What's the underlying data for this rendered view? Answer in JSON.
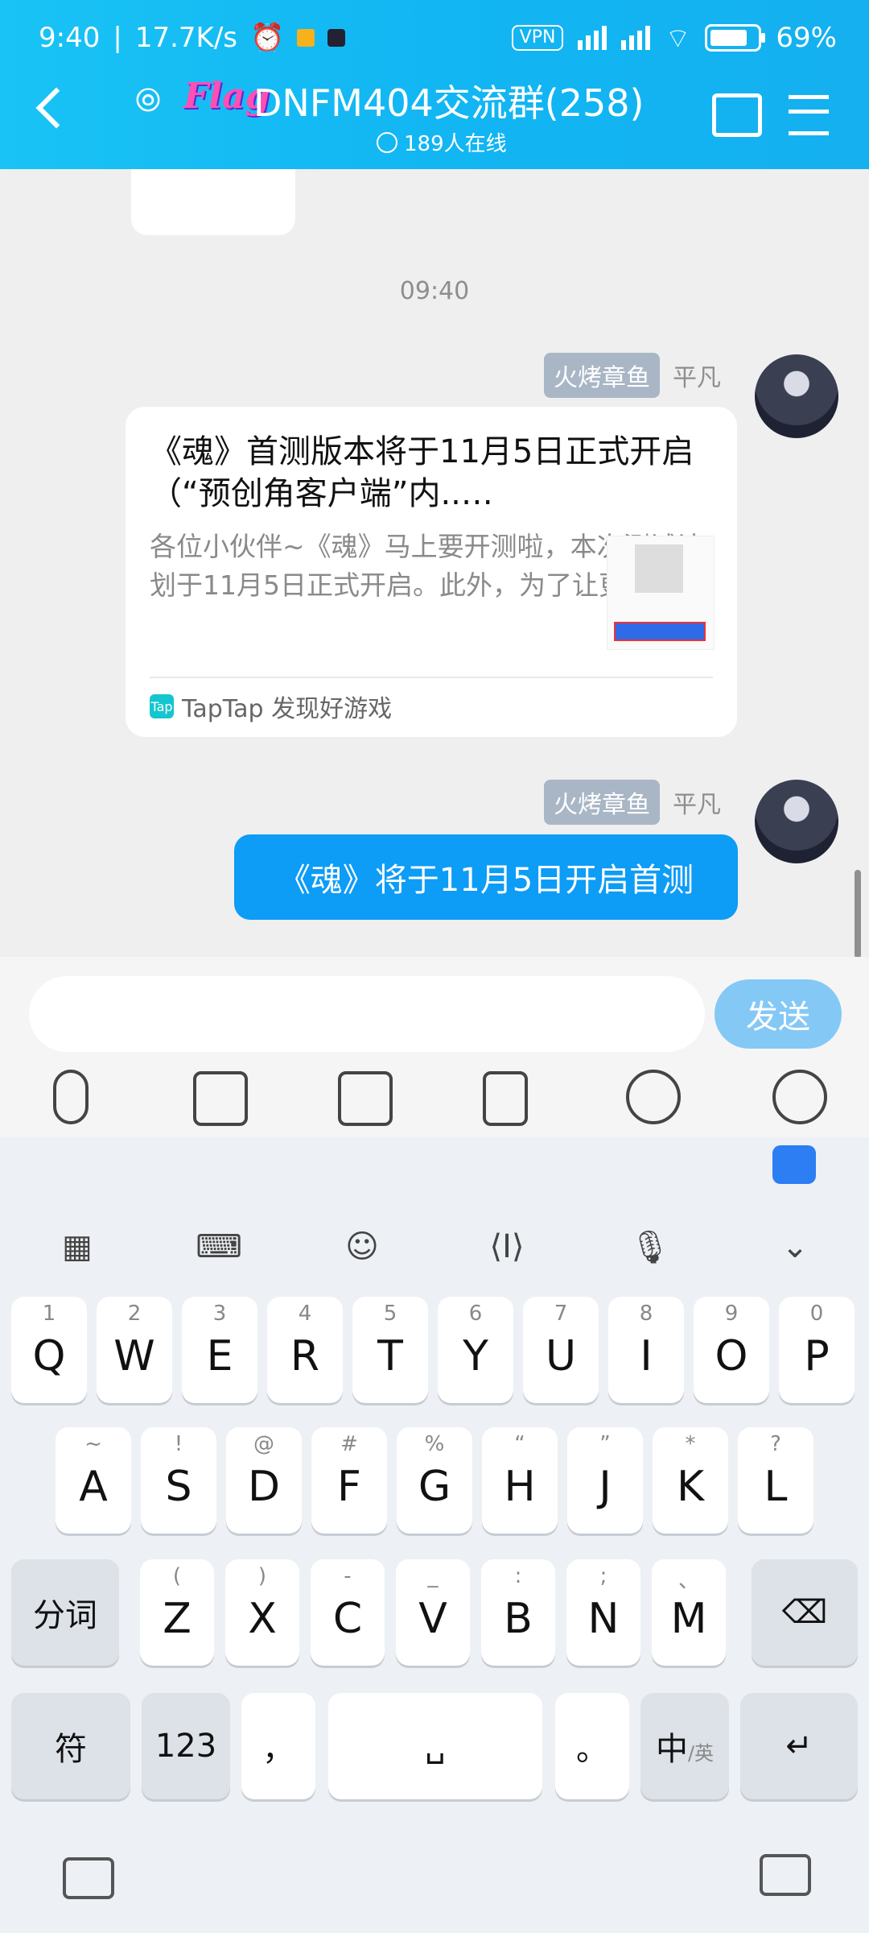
{
  "status_bar": {
    "time": "9:40",
    "speed": "17.7K/s",
    "vpn": "VPN",
    "battery": "69%"
  },
  "header": {
    "logo_text": "Flag",
    "title": "DNFM404交流群(258)",
    "online": "189人在线"
  },
  "chat": {
    "time_separator": "09:40",
    "messages": [
      {
        "tag": "火烤章鱼",
        "name": "平凡",
        "card": {
          "title": "《魂》首测版本将于11月5日正式开启（“预创角客户端”内..…",
          "desc": "各位小伙伴~《魂》马上要开测啦，本次测试计划于11月5日正式开启。此外，为了让更…",
          "source": "TapTap 发现好游戏"
        }
      },
      {
        "tag": "火烤章鱼",
        "name": "平凡",
        "text": "《魂》将于11月5日开启首测"
      }
    ]
  },
  "input": {
    "placeholder": "",
    "send_label": "发送"
  },
  "keyboard": {
    "row1": [
      {
        "sub": "1",
        "main": "Q"
      },
      {
        "sub": "2",
        "main": "W"
      },
      {
        "sub": "3",
        "main": "E"
      },
      {
        "sub": "4",
        "main": "R"
      },
      {
        "sub": "5",
        "main": "T"
      },
      {
        "sub": "6",
        "main": "Y"
      },
      {
        "sub": "7",
        "main": "U"
      },
      {
        "sub": "8",
        "main": "I"
      },
      {
        "sub": "9",
        "main": "O"
      },
      {
        "sub": "0",
        "main": "P"
      }
    ],
    "row2": [
      {
        "sub": "~",
        "main": "A"
      },
      {
        "sub": "!",
        "main": "S"
      },
      {
        "sub": "@",
        "main": "D"
      },
      {
        "sub": "#",
        "main": "F"
      },
      {
        "sub": "%",
        "main": "G"
      },
      {
        "sub": "“",
        "main": "H"
      },
      {
        "sub": "”",
        "main": "J"
      },
      {
        "sub": "*",
        "main": "K"
      },
      {
        "sub": "?",
        "main": "L"
      }
    ],
    "row3": [
      {
        "sub": "(",
        "main": "Z"
      },
      {
        "sub": ")",
        "main": "X"
      },
      {
        "sub": "-",
        "main": "C"
      },
      {
        "sub": "_",
        "main": "V"
      },
      {
        "sub": ":",
        "main": "B"
      },
      {
        "sub": ";",
        "main": "N"
      },
      {
        "sub": "、",
        "main": "M"
      }
    ],
    "fenci": "分词",
    "fu": "符",
    "num": "123",
    "comma": "，",
    "period": "。",
    "zh": "中",
    "en": "/英"
  }
}
